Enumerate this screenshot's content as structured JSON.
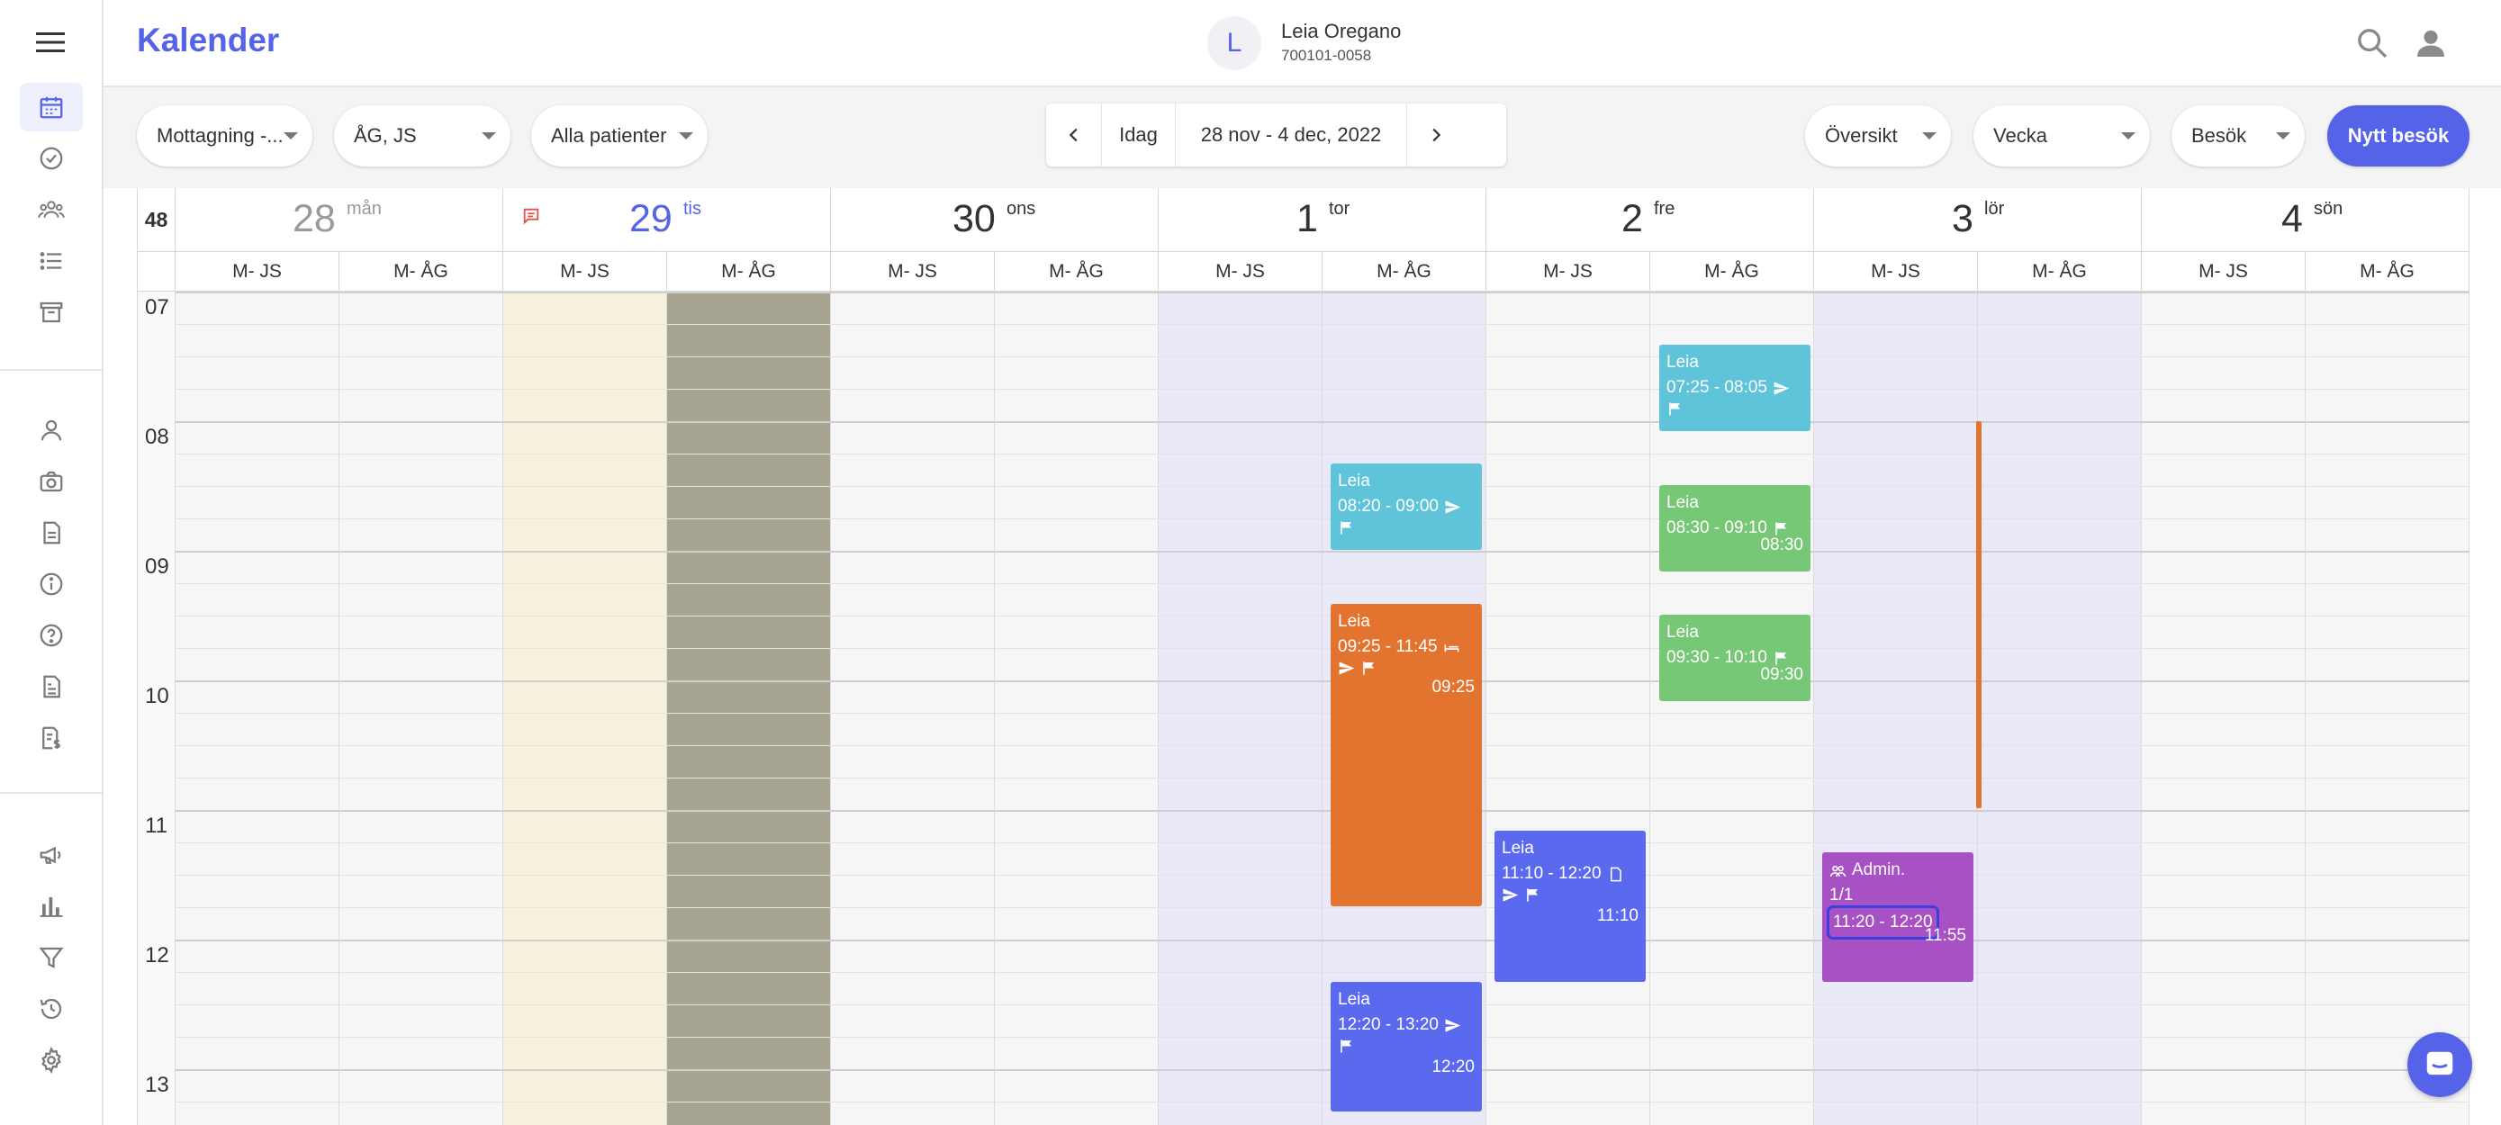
{
  "app": {
    "title": "Kalender"
  },
  "patient": {
    "initial": "L",
    "name": "Leia Oregano",
    "id": "700101-0058"
  },
  "filters": [
    {
      "key": "clinic",
      "label": "Mottagning -..."
    },
    {
      "key": "staff",
      "label": "ÅG, JS"
    },
    {
      "key": "patients",
      "label": "Alla patienter"
    }
  ],
  "nav": {
    "today": "Idag",
    "range": "28 nov - 4 dec, 2022"
  },
  "view": {
    "mode": "Översikt",
    "span": "Vecka",
    "type": "Besök",
    "new_button": "Nytt besök"
  },
  "week": "48",
  "days": [
    {
      "num": "28",
      "name": "mån",
      "state": "past"
    },
    {
      "num": "29",
      "name": "tis",
      "state": "today"
    },
    {
      "num": "30",
      "name": "ons",
      "state": ""
    },
    {
      "num": "1",
      "name": "tor",
      "state": ""
    },
    {
      "num": "2",
      "name": "fre",
      "state": ""
    },
    {
      "num": "3",
      "name": "lör",
      "state": ""
    },
    {
      "num": "4",
      "name": "sön",
      "state": ""
    }
  ],
  "resources": [
    "M- JS",
    "M- ÅG"
  ],
  "hours": [
    "07",
    "08",
    "09",
    "10",
    "11",
    "12",
    "13"
  ],
  "events": [
    {
      "id": "ev1",
      "color": "#5fc4d9",
      "title": "Leia",
      "time": "07:25 - 08:05",
      "icons": [
        "send"
      ],
      "icons2": [
        "flag"
      ],
      "right": ""
    },
    {
      "id": "ev2",
      "color": "#5fc4d9",
      "title": "Leia",
      "time": "08:20 - 09:00",
      "icons": [
        "send"
      ],
      "icons2": [
        "flag"
      ],
      "right": ""
    },
    {
      "id": "ev3",
      "color": "#76c776",
      "title": "Leia",
      "time": "08:30 - 09:10",
      "icons": [
        "flag"
      ],
      "icons2": [],
      "right": "08:30"
    },
    {
      "id": "ev4",
      "color": "#76c776",
      "title": "Leia",
      "time": "09:30 - 10:10",
      "icons": [
        "flag"
      ],
      "icons2": [],
      "right": "09:30"
    },
    {
      "id": "ev5",
      "color": "#e37430",
      "title": "Leia",
      "time": "09:25 - 11:45",
      "icons": [
        "bed"
      ],
      "icons2": [
        "send",
        "flag"
      ],
      "right": "09:25"
    },
    {
      "id": "ev6",
      "color": "#5b69ee",
      "title": "Leia",
      "time": "11:10 - 12:20",
      "icons": [
        "doc"
      ],
      "icons2": [
        "send",
        "flag"
      ],
      "right": "11:10"
    },
    {
      "id": "ev7",
      "color": "#a851c4",
      "title": "Admin.",
      "sub": "1/1",
      "time": "11:20 - 12:20",
      "icons": [],
      "icons2": [],
      "right": "11:55"
    },
    {
      "id": "ev8",
      "color": "#5b69ee",
      "title": "Leia",
      "time": "12:20 - 13:20",
      "icons": [
        "send"
      ],
      "icons2": [
        "flag"
      ],
      "right": "12:20"
    }
  ],
  "colors": {
    "accent": "#5563e8",
    "orange": "#e37430",
    "cyan": "#5fc4d9",
    "green": "#76c776",
    "purple": "#a851c4",
    "blue": "#5b69ee"
  }
}
